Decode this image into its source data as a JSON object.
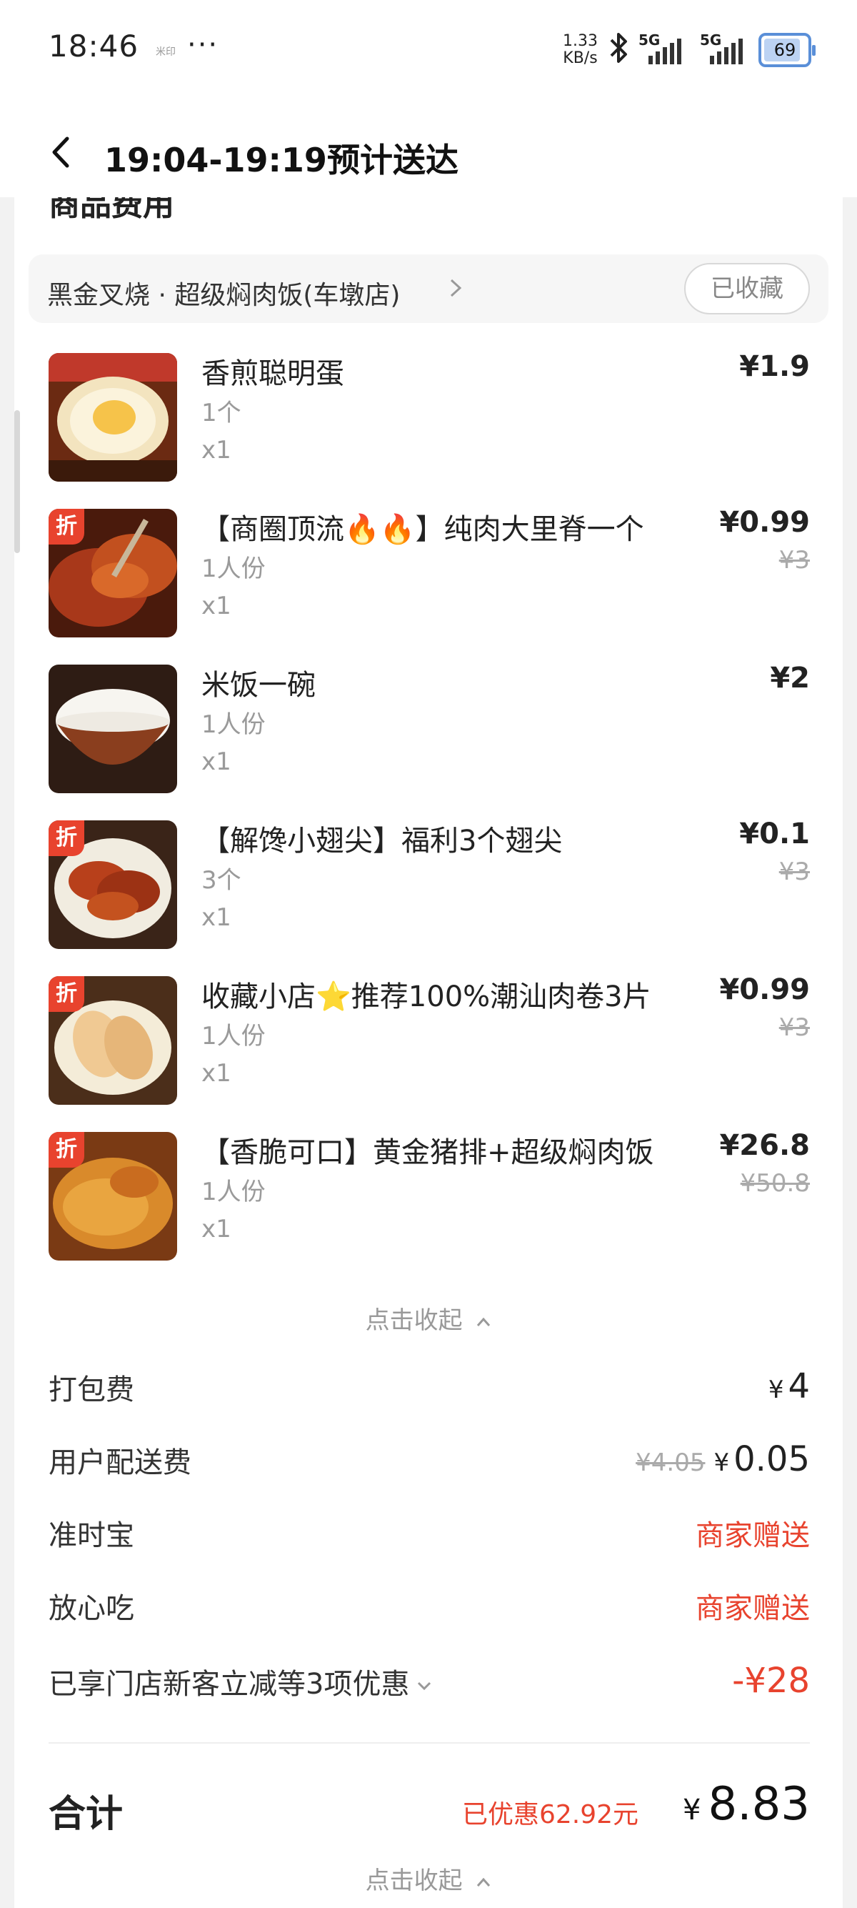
{
  "status_bar": {
    "time": "18:46",
    "small_tag": "米印",
    "dots": "···",
    "speed_value": "1.33",
    "speed_unit": "KB/s",
    "signal1": "5G",
    "signal2": "5G",
    "battery": "69"
  },
  "header": {
    "title": "19:04-19:19预计送达"
  },
  "section": {
    "title": "商品费用"
  },
  "shop": {
    "name": "黑金叉烧 · 超级焖肉饭(车墩店)",
    "fav_label": "已收藏"
  },
  "items": [
    {
      "name": "香煎聪明蛋",
      "spec": "1个",
      "qty": "x1",
      "price": "¥1.9",
      "orig": "",
      "discount": ""
    },
    {
      "name": "【商圈顶流🔥🔥】纯肉大里脊一个",
      "spec": "1人份",
      "qty": "x1",
      "price": "¥0.99",
      "orig": "¥3",
      "discount": "折"
    },
    {
      "name": "米饭一碗",
      "spec": "1人份",
      "qty": "x1",
      "price": "¥2",
      "orig": "",
      "discount": ""
    },
    {
      "name": "【解馋小翅尖】福利3个翅尖",
      "spec": "3个",
      "qty": "x1",
      "price": "¥0.1",
      "orig": "¥3",
      "discount": "折"
    },
    {
      "name": "收藏小店⭐推荐100%潮汕肉卷3片",
      "spec": "1人份",
      "qty": "x1",
      "price": "¥0.99",
      "orig": "¥3",
      "discount": "折"
    },
    {
      "name": "【香脆可口】黄金猪排+超级焖肉饭",
      "spec": "1人份",
      "qty": "x1",
      "price": "¥26.8",
      "orig": "¥50.8",
      "discount": "折"
    }
  ],
  "collapse_label": "点击收起",
  "fees": {
    "packing_label": "打包费",
    "packing_yen": "¥",
    "packing_value": "4",
    "delivery_label": "用户配送费",
    "delivery_orig": "¥4.05",
    "delivery_yen": "¥",
    "delivery_value": "0.05",
    "ontime_label": "准时宝",
    "ontime_value": "商家赠送",
    "safe_label": "放心吃",
    "safe_value": "商家赠送",
    "promo_label": "已享门店新客立减等3项优惠",
    "promo_value": "-¥28"
  },
  "total": {
    "label": "合计",
    "saved": "已优惠62.92元",
    "yen": "¥",
    "amount": "8.83"
  },
  "colors": {
    "accent_red": "#e8432e",
    "battery_blue": "#5a8fd8"
  }
}
